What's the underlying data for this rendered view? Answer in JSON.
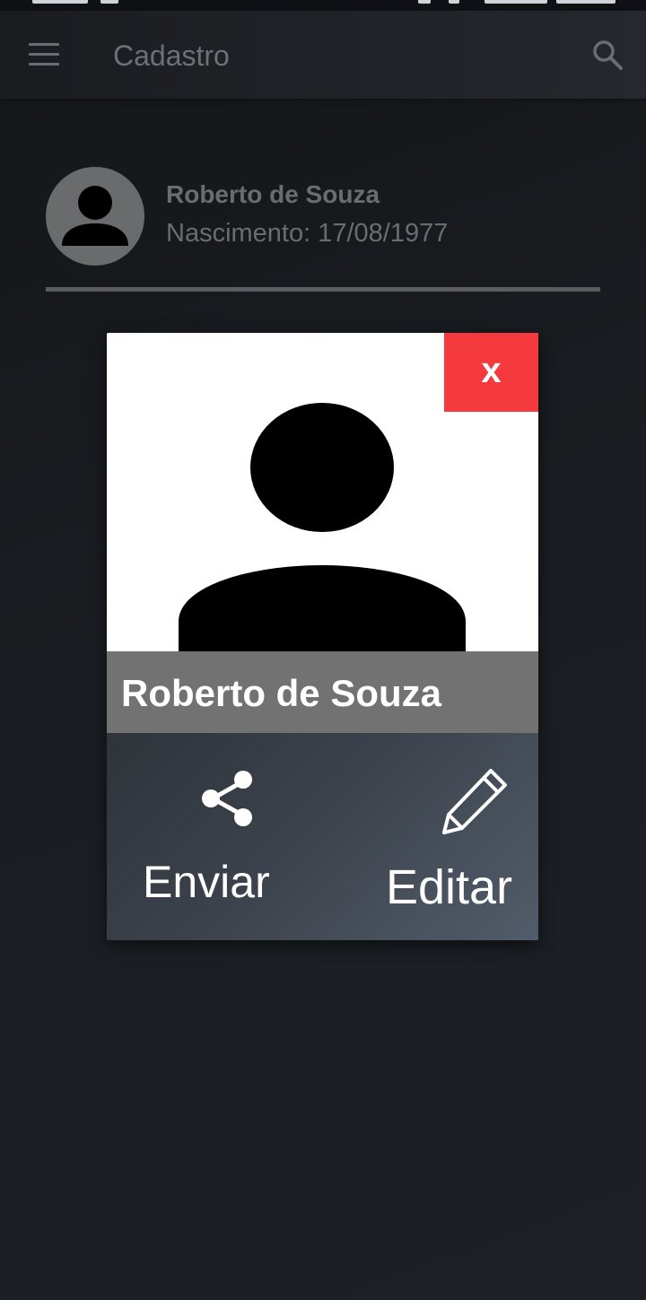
{
  "app_bar": {
    "title": "Cadastro",
    "menu_icon": "hamburger-menu-icon",
    "search_icon": "search-icon"
  },
  "record": {
    "avatar_icon": "person-icon",
    "name": "Roberto de Souza",
    "birth": "Nascimento: 17/08/1977"
  },
  "dialog": {
    "close_label": "x",
    "close_color": "#f43a3d",
    "photo_icon": "person-silhouette-icon",
    "name": "Roberto de Souza",
    "actions": {
      "send_label": "Enviar",
      "send_icon": "share-icon",
      "edit_label": "Editar",
      "edit_icon": "pencil-icon"
    }
  }
}
